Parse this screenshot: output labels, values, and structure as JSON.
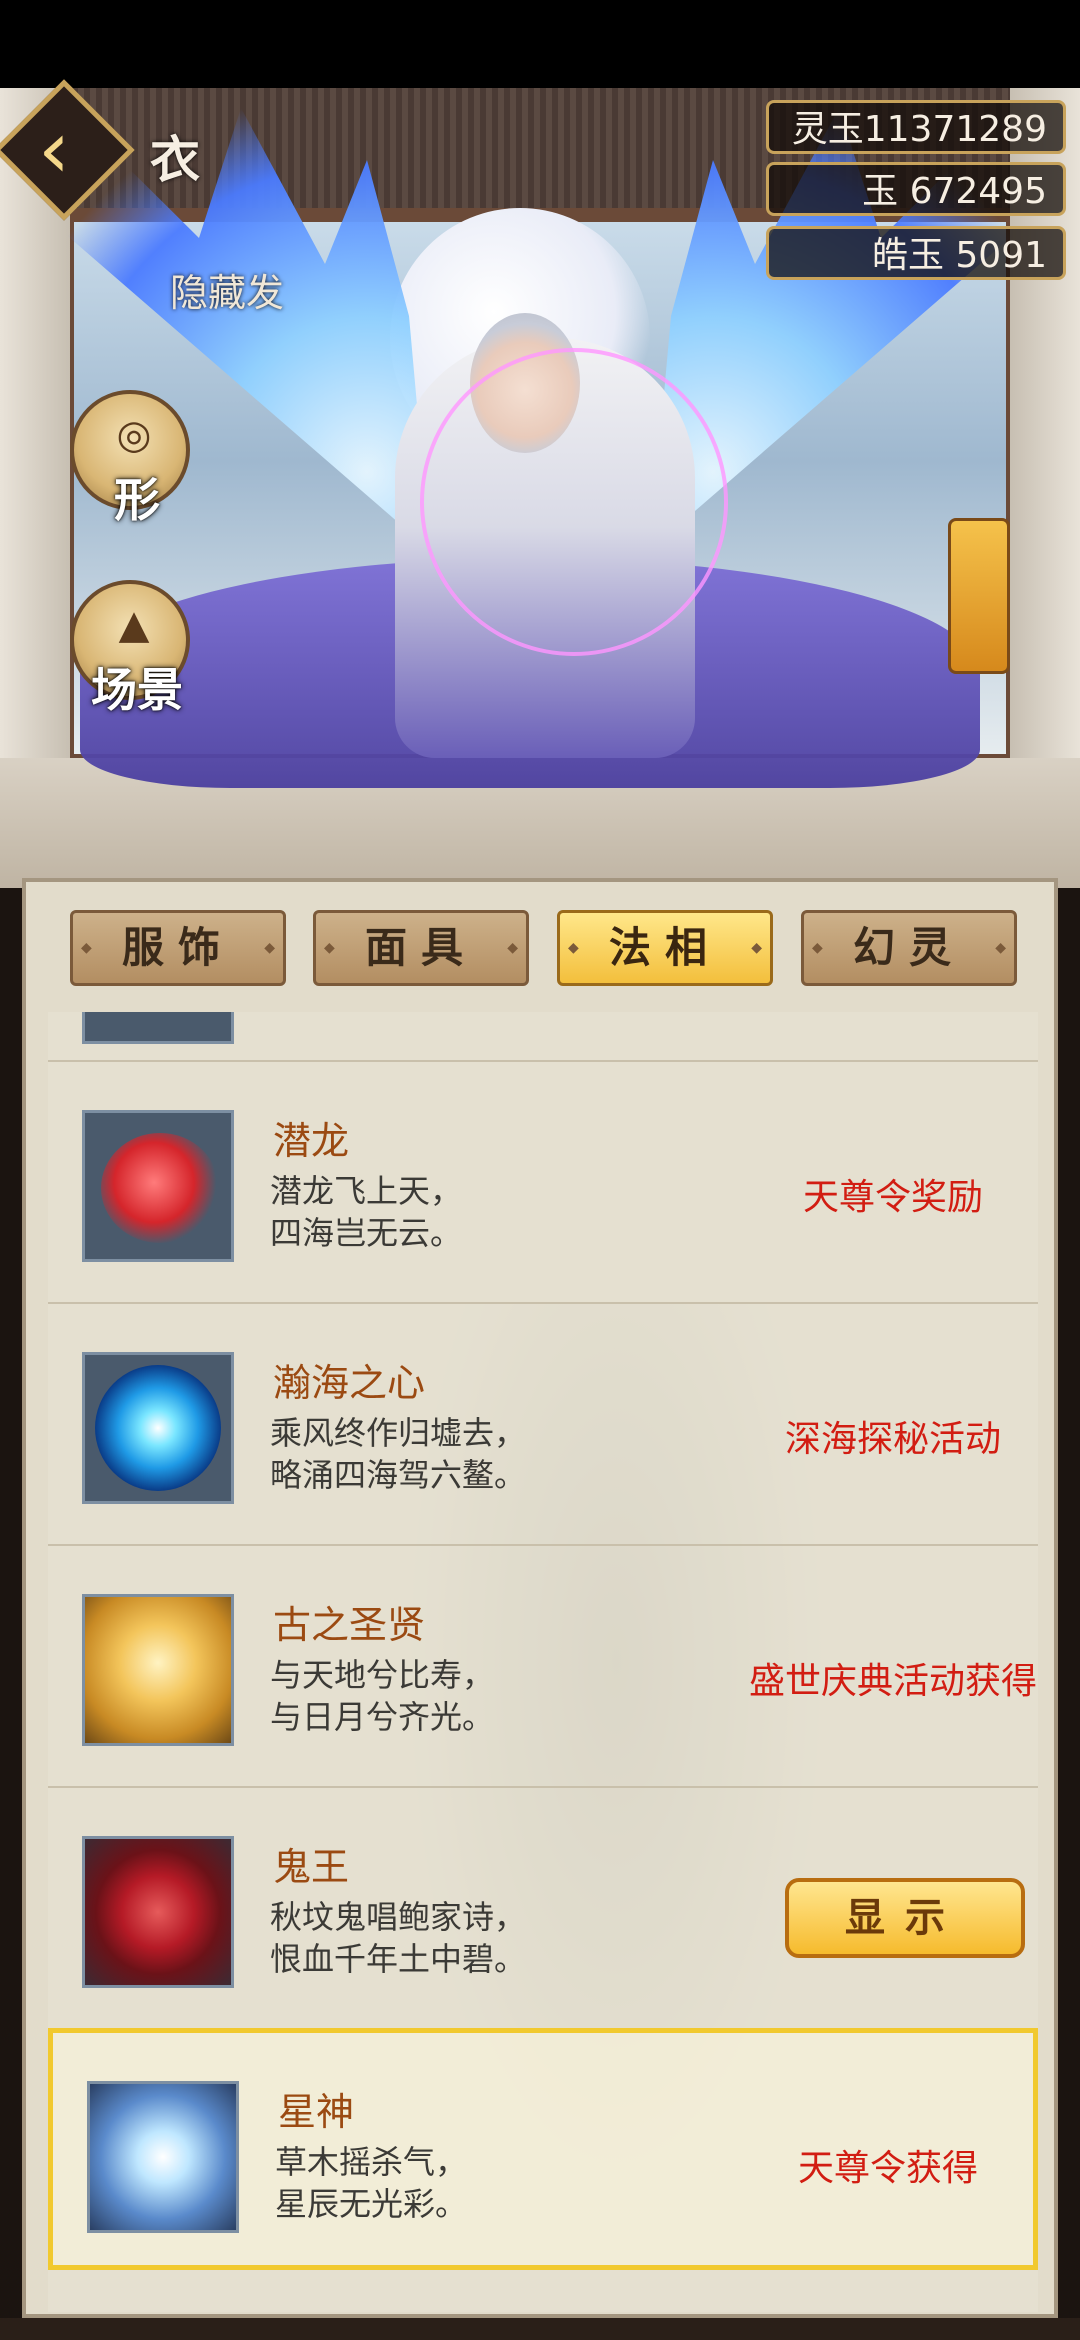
{
  "header": {
    "title_fragment": "衣",
    "subtitle_fragment": "隐藏发"
  },
  "currencies": [
    {
      "label": "灵玉",
      "value": "11371289",
      "display": "灵玉11371289"
    },
    {
      "label": "玉",
      "value": "672495",
      "display": "玉  672495"
    },
    {
      "label": "皓玉",
      "value": "5091",
      "display": "皓玉  5091"
    }
  ],
  "side_buttons": [
    {
      "label": "形"
    },
    {
      "label": "场景"
    }
  ],
  "tabs": [
    {
      "label": "服饰",
      "active": false
    },
    {
      "label": "面具",
      "active": false
    },
    {
      "label": "法相",
      "active": true
    },
    {
      "label": "幻灵",
      "active": false
    }
  ],
  "items": [
    {
      "name": "潜龙",
      "desc1": "潜龙飞上天，",
      "desc2": "四海岂无云。",
      "source": "天尊令奖励",
      "icon": "red-dragon-icon"
    },
    {
      "name": "瀚海之心",
      "desc1": "乘风终作归墟去，",
      "desc2": "略涌四海驾六鳌。",
      "source": "深海探秘活动",
      "icon": "blue-vortex-icon"
    },
    {
      "name": "古之圣贤",
      "desc1": "与天地兮比寿，",
      "desc2": "与日月兮齐光。",
      "source": "盛世庆典活动获得",
      "icon": "golden-sage-icon"
    },
    {
      "name": "鬼王",
      "desc1": "秋坟鬼唱鲍家诗，",
      "desc2": "恨血千年土中碧。",
      "source": "",
      "icon": "red-demon-icon",
      "button": "显示"
    },
    {
      "name": "星神",
      "desc1": "草木摇杀气，",
      "desc2": "星辰无光彩。",
      "source": "天尊令获得",
      "icon": "ice-wings-icon",
      "selected": true
    }
  ],
  "colors": {
    "accent_gold": "#f3bf3c",
    "source_red": "#d21d12",
    "name_brown": "#9b4a12",
    "selected_border": "#f1c92e"
  }
}
